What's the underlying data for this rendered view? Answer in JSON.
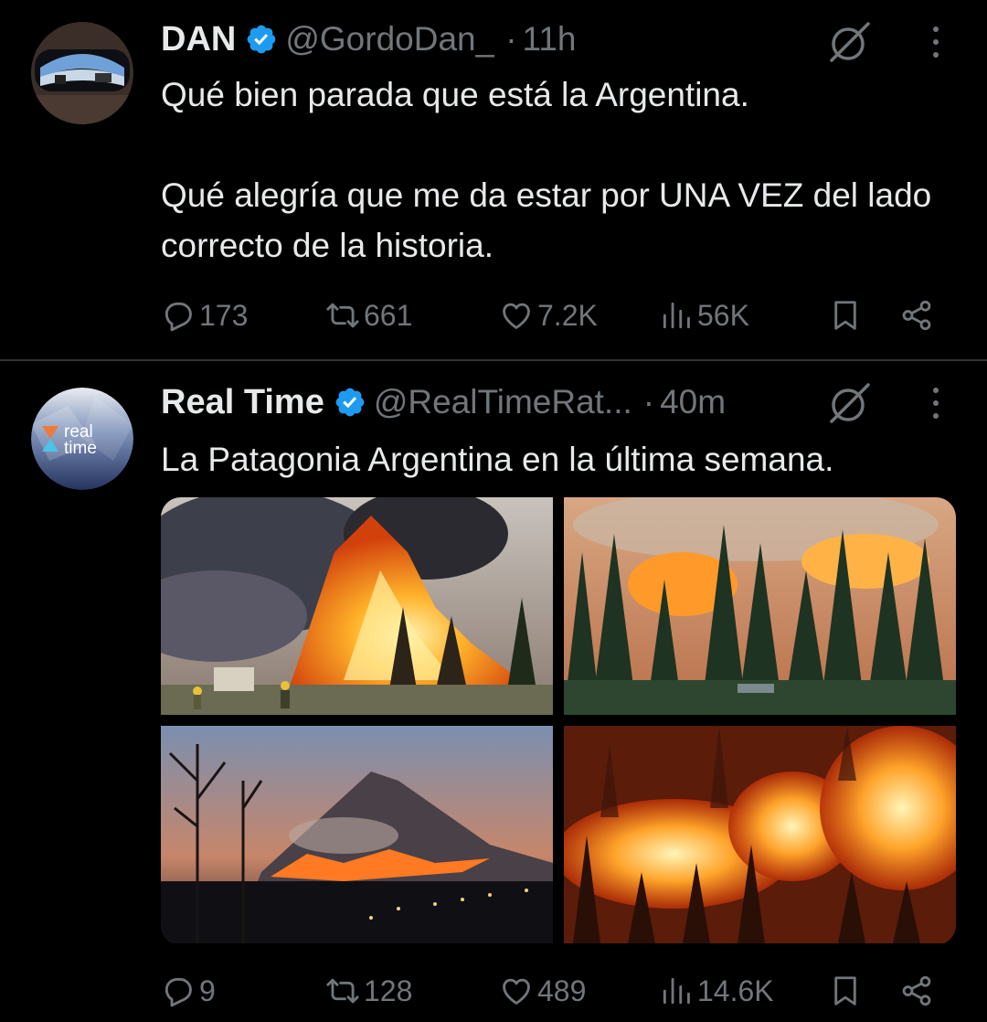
{
  "tweets": [
    {
      "author": {
        "name": "DAN",
        "handle": "@GordoDan_",
        "verified": true,
        "avatar_icon": "sunglasses-reflection-avatar"
      },
      "separator": "·",
      "time": "11h",
      "paragraphs": [
        "Qué bien parada que está la Argentina.",
        "Qué alegría que me da estar por UNA VEZ del lado correcto de la historia."
      ],
      "stats": {
        "replies": "173",
        "reposts": "661",
        "likes": "7.2K",
        "views": "56K"
      }
    },
    {
      "author": {
        "name": "Real Time",
        "handle": "@RealTimeRat...",
        "verified": true,
        "avatar_icon": "real-time-logo",
        "avatar_text": [
          "real",
          "time"
        ]
      },
      "separator": "·",
      "time": "40m",
      "paragraphs": [
        "La Patagonia Argentina en la última semana."
      ],
      "media": [
        {
          "icon": "forest-fire-photo-with-firefighters"
        },
        {
          "icon": "burning-pine-forest-photo"
        },
        {
          "icon": "burning-mountain-at-dusk-photo"
        },
        {
          "icon": "night-forest-fire-photo"
        }
      ],
      "stats": {
        "replies": "9",
        "reposts": "128",
        "likes": "489",
        "views": "14.6K"
      }
    }
  ],
  "colors": {
    "background": "#000000",
    "text": "#e7e9ea",
    "muted": "#71767b",
    "verified": "#1d9bf0",
    "divider": "#2f3336"
  },
  "icons": [
    "reply-icon",
    "repost-icon",
    "like-icon",
    "views-icon",
    "bookmark-icon",
    "share-icon",
    "grok-icon",
    "more-icon",
    "verified-badge-icon"
  ]
}
